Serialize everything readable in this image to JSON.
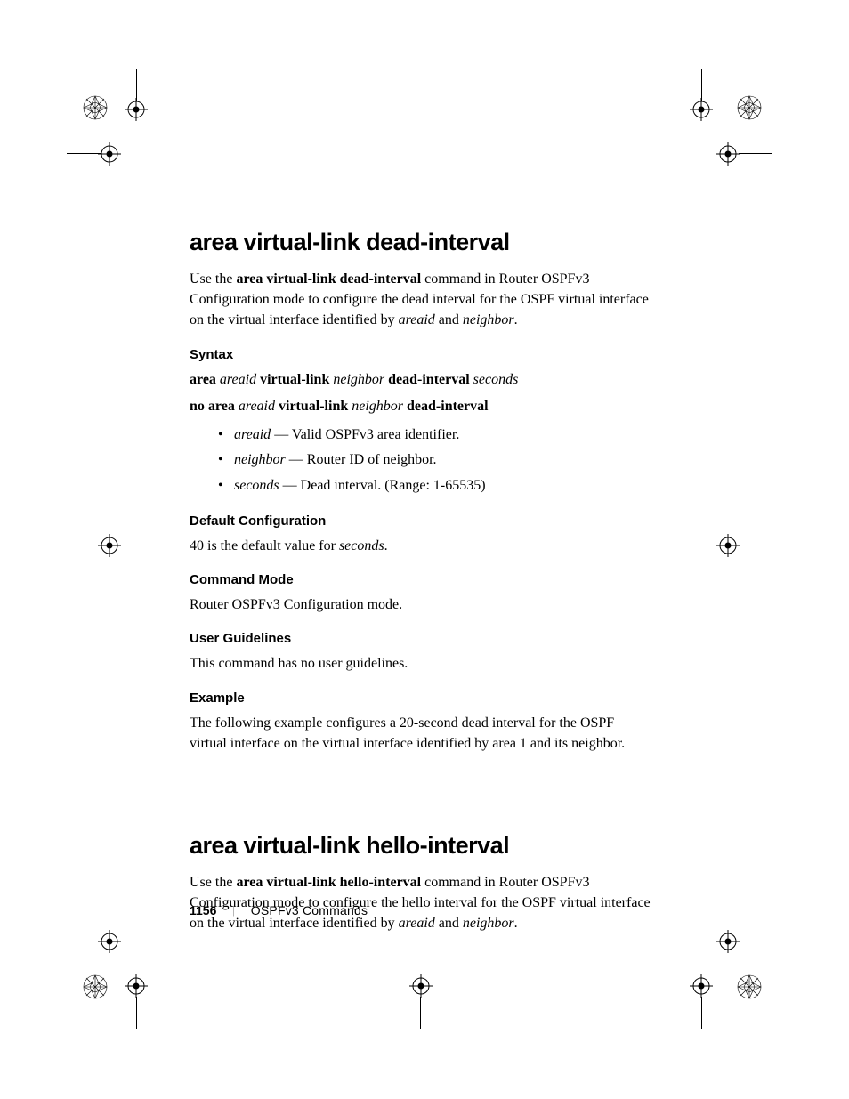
{
  "section1": {
    "title": "area virtual-link dead-interval",
    "intro_parts": {
      "pre": "Use the ",
      "bold": "area virtual-link dead-interval",
      "mid": " command in Router OSPFv3 Configuration mode to configure the dead interval for the OSPF virtual interface on the virtual interface identified by ",
      "it1": "areaid",
      "and": " and ",
      "it2": "neighbor",
      "end": "."
    },
    "syntax": {
      "heading": "Syntax",
      "line1": {
        "p1": "area",
        "i1": "areaid",
        "p2": " virtual-link",
        "i2": "neighbor",
        "p3": "dead-interval",
        "i3": "seconds"
      },
      "line2": {
        "p1": "no area",
        "i1": "areaid",
        "p2": " virtual-link",
        "i2": "neighbor",
        "p3": "dead-interval"
      },
      "params": [
        {
          "term": "areaid",
          "desc": " — Valid OSPFv3 area identifier."
        },
        {
          "term": "neighbor",
          "desc": " — Router ID of neighbor."
        },
        {
          "term": "seconds",
          "desc": " — Dead interval. (Range: 1-65535)"
        }
      ]
    },
    "default_cfg": {
      "heading": "Default Configuration",
      "pre": "40 is the default value for ",
      "it": "seconds",
      "end": "."
    },
    "cmd_mode": {
      "heading": "Command Mode",
      "text": "Router OSPFv3 Configuration mode."
    },
    "guidelines": {
      "heading": "User Guidelines",
      "text": "This command has no user guidelines."
    },
    "example": {
      "heading": "Example",
      "text": "The following example configures a 20-second dead interval for the OSPF virtual interface on the virtual interface identified by area 1 and its neighbor."
    }
  },
  "section2": {
    "title": "area virtual-link hello-interval",
    "intro_parts": {
      "pre": "Use the ",
      "bold": "area virtual-link hello-interval",
      "mid": " command in Router OSPFv3 Configuration mode to configure the hello interval for the OSPF virtual interface on the virtual interface identified by ",
      "it1": "areaid",
      "and": " and ",
      "it2": "neighbor",
      "end": "."
    }
  },
  "footer": {
    "page": "1156",
    "chapter": "OSPFv3 Commands"
  }
}
